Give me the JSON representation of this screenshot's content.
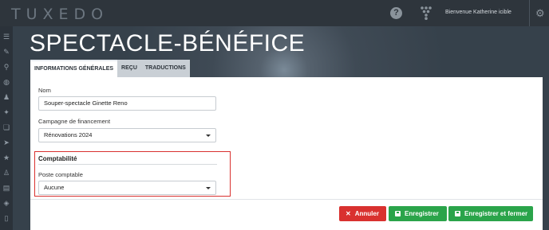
{
  "topbar": {
    "logo": "TUXEDO",
    "help_symbol": "?",
    "welcome": "Bienvenue Katherine icible",
    "icons": [
      "help-icon",
      "t-funnel-icon",
      "gear-icon"
    ]
  },
  "sidebar": {
    "icons": [
      "menu-icon",
      "ticket-icon",
      "search-icon",
      "palette-icon",
      "users-icon",
      "magic-wand-icon",
      "coupons-icon",
      "send-icon",
      "star-icon",
      "user-plus-icon",
      "id-card-icon",
      "tags-icon",
      "mobile-icon"
    ]
  },
  "page": {
    "title": "SPECTACLE-BÉNÉFICE"
  },
  "tabs": [
    {
      "label": "INFORMATIONS GÉNÉRALES",
      "active": true
    },
    {
      "label": "REÇU",
      "active": false
    },
    {
      "label": "TRADUCTIONS",
      "active": false
    }
  ],
  "form": {
    "name_label": "Nom",
    "name_value": "Souper-spectacle Ginette Reno",
    "campaign_label": "Campagne de financement",
    "campaign_value": "Rénovations 2024",
    "accounting_title": "Comptabilité",
    "account_label": "Poste comptable",
    "account_value": "Aucune"
  },
  "buttons": {
    "cancel": "Annuler",
    "save": "Enregistrer",
    "save_close": "Enregistrer et fermer"
  },
  "colors": {
    "topbar": "#2e353c",
    "cancel": "#d9312f",
    "save": "#2aa44a",
    "highlight": "#d9312f"
  }
}
